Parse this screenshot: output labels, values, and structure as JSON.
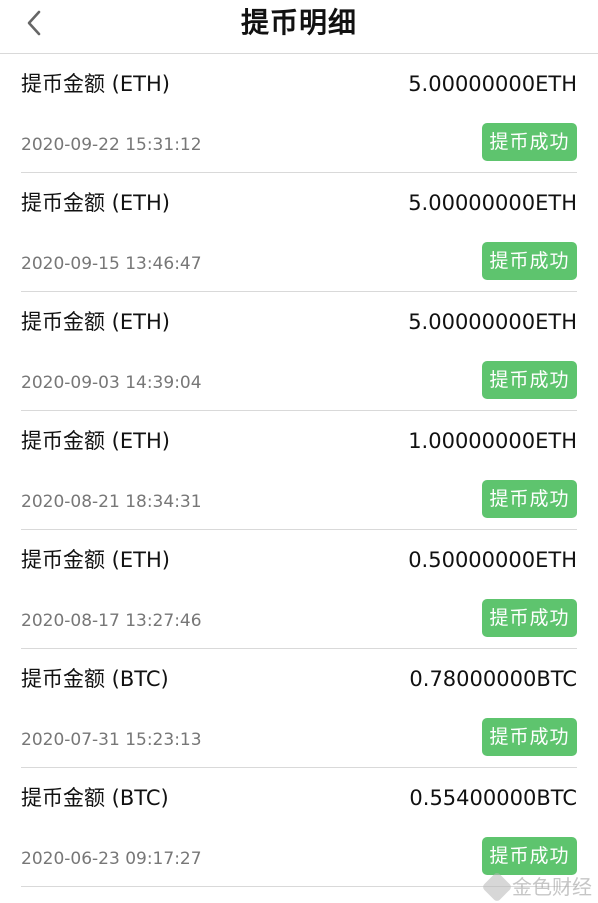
{
  "header": {
    "title": "提币明细",
    "back_icon": "chevron-left-icon"
  },
  "records": [
    {
      "label": "提币金额 (ETH)",
      "amount": "5.00000000ETH",
      "time": "2020-09-22 15:31:12",
      "status": "提币成功"
    },
    {
      "label": "提币金额 (ETH)",
      "amount": "5.00000000ETH",
      "time": "2020-09-15 13:46:47",
      "status": "提币成功"
    },
    {
      "label": "提币金额 (ETH)",
      "amount": "5.00000000ETH",
      "time": "2020-09-03 14:39:04",
      "status": "提币成功"
    },
    {
      "label": "提币金额 (ETH)",
      "amount": "1.00000000ETH",
      "time": "2020-08-21 18:34:31",
      "status": "提币成功"
    },
    {
      "label": "提币金额 (ETH)",
      "amount": "0.50000000ETH",
      "time": "2020-08-17 13:27:46",
      "status": "提币成功"
    },
    {
      "label": "提币金额 (BTC)",
      "amount": "0.78000000BTC",
      "time": "2020-07-31 15:23:13",
      "status": "提币成功"
    },
    {
      "label": "提币金额 (BTC)",
      "amount": "0.55400000BTC",
      "time": "2020-06-23 09:17:27",
      "status": "提币成功"
    }
  ],
  "watermark": {
    "text": "金色财经"
  },
  "colors": {
    "status_success": "#5ec46e",
    "divider": "#d9d9d9",
    "time_text": "#777777"
  }
}
